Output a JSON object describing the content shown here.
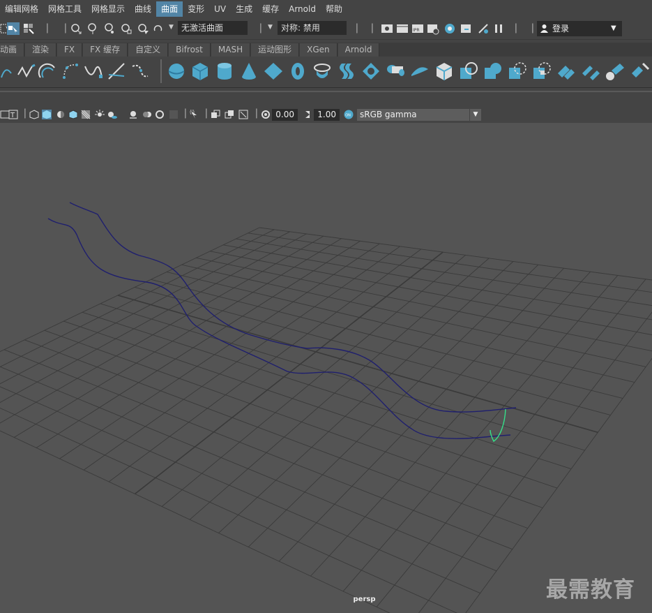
{
  "menu": {
    "items": [
      "编辑网格",
      "网格工具",
      "网格显示",
      "曲线",
      "曲面",
      "变形",
      "UV",
      "生成",
      "缓存",
      "Arnold",
      "帮助"
    ],
    "active_index": 4
  },
  "status_line": {
    "live_surface": "无激活曲面",
    "symmetry": "对称: 禁用",
    "login": "登录"
  },
  "shelf_tabs": [
    "动画",
    "渲染",
    "FX",
    "FX 缓存",
    "自定义",
    "Bifrost",
    "MASH",
    "运动图形",
    "XGen",
    "Arnold"
  ],
  "panel_toolbar": {
    "exposure": "0.00",
    "gamma": "1.00",
    "color_space": "sRGB gamma"
  },
  "viewport": {
    "camera": "persp",
    "watermark": "最需教育",
    "background_color": "#545454",
    "grid_color": "#3a3a3a",
    "curve_color": "#1f1f6e",
    "selected_curve_color": "#35e08a"
  },
  "colors": {
    "accent": "#5285a6",
    "icon_blue": "#4fa9cc"
  }
}
